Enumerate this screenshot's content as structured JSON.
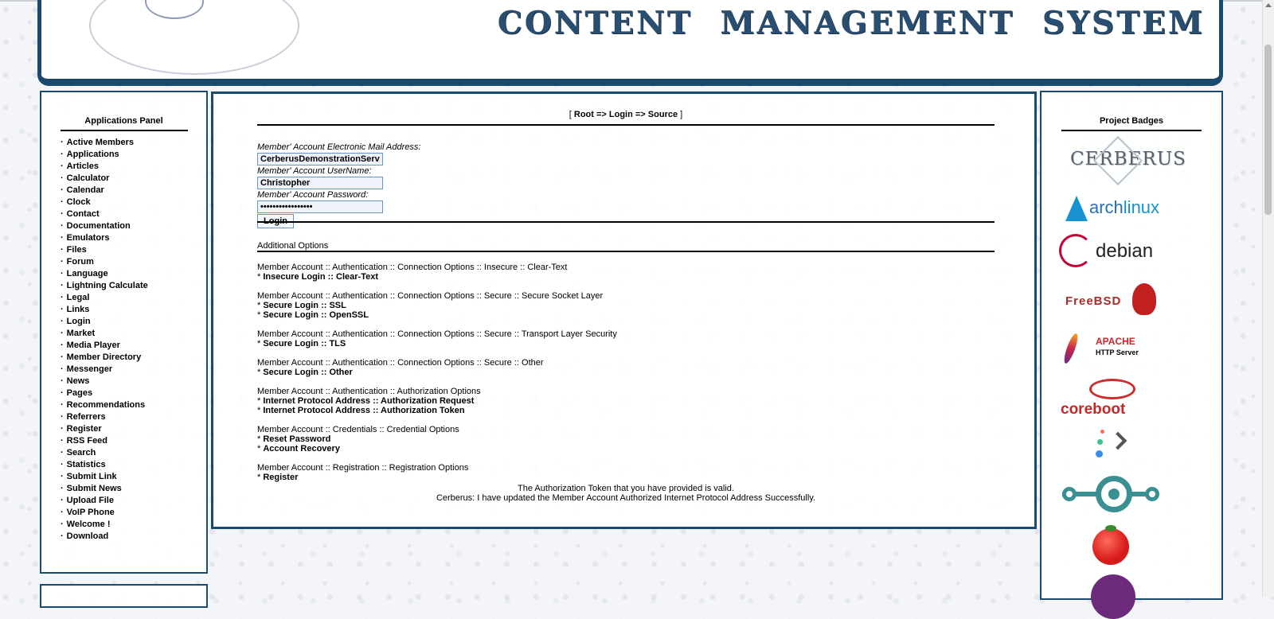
{
  "header": {
    "title": "CONTENT MANAGEMENT SYSTEM"
  },
  "apps_panel": {
    "title": "Applications Panel",
    "items": [
      "Active Members",
      "Applications",
      "Articles",
      "Calculator",
      "Calendar",
      "Clock",
      "Contact",
      "Documentation",
      "Emulators",
      "Files",
      "Forum",
      "Language",
      "Lightning Calculate",
      "Legal",
      "Links",
      "Login",
      "Market",
      "Media Player",
      "Member Directory",
      "Messenger",
      "News",
      "Pages",
      "Recommendations",
      "Referrers",
      "Register",
      "RSS Feed",
      "Search",
      "Statistics",
      "Submit Link",
      "Submit News",
      "Upload File",
      "VoIP Phone",
      "Welcome !",
      "Download"
    ]
  },
  "main": {
    "breadcrumb": {
      "open": "[ ",
      "text": "Root => Login => Source",
      "close": " ]"
    },
    "form": {
      "email_label": "Member' Account Electronic Mail Address",
      "email_value": "CerberusDemonstrationServer",
      "username_label": "Member' Account UserName",
      "username_value": "Christopher",
      "password_label": "Member' Account Password",
      "password_value": "•••••••••••••••••",
      "login_button": "Login"
    },
    "additional_options_title": "Additional Options",
    "option_groups": [
      {
        "heading": "Member Account :: Authentication :: Connection Options :: Insecure :: Clear-Text",
        "links": [
          "Insecure Login :: Clear-Text"
        ]
      },
      {
        "heading": "Member Account :: Authentication :: Connection Options :: Secure :: Secure Socket Layer",
        "links": [
          "Secure Login :: SSL",
          "Secure Login :: OpenSSL"
        ]
      },
      {
        "heading": "Member Account :: Authentication :: Connection Options :: Secure :: Transport Layer Security",
        "links": [
          "Secure Login :: TLS"
        ]
      },
      {
        "heading": "Member Account :: Authentication :: Connection Options :: Secure :: Other",
        "links": [
          "Secure Login :: Other"
        ]
      },
      {
        "heading": "Member Account :: Authentication :: Authorization Options",
        "links": [
          "Internet Protocol Address :: Authorization Request",
          "Internet Protocol Address :: Authorization Token"
        ]
      },
      {
        "heading": "Member Account :: Credentials :: Credential Options",
        "links": [
          "Reset Password",
          "Account Recovery"
        ]
      },
      {
        "heading": "Member Account :: Registration :: Registration Options",
        "links": [
          "Register"
        ]
      }
    ],
    "status_lines": [
      "The Authorization Token that you have provided is valid.",
      "Cerberus: I have updated the Member Account Authorized Internet Protocol Address Successfully."
    ]
  },
  "badges_panel": {
    "title": "Project Badges",
    "badges": [
      {
        "name": "cerberus-badge",
        "text": "CERBERUS"
      },
      {
        "name": "archlinux-badge",
        "text_a": "arch",
        "text_b": "linux"
      },
      {
        "name": "debian-badge",
        "text": "debian"
      },
      {
        "name": "freebsd-badge",
        "text": "FreeBSD"
      },
      {
        "name": "apache-badge",
        "text_a": "APACHE",
        "text_b": "HTTP Server"
      },
      {
        "name": "coreboot-badge",
        "text": "coreboot"
      }
    ]
  },
  "colors": {
    "frame": "#1a4a6e",
    "title": "#2a4e6f",
    "input_border": "#6a94c2"
  }
}
